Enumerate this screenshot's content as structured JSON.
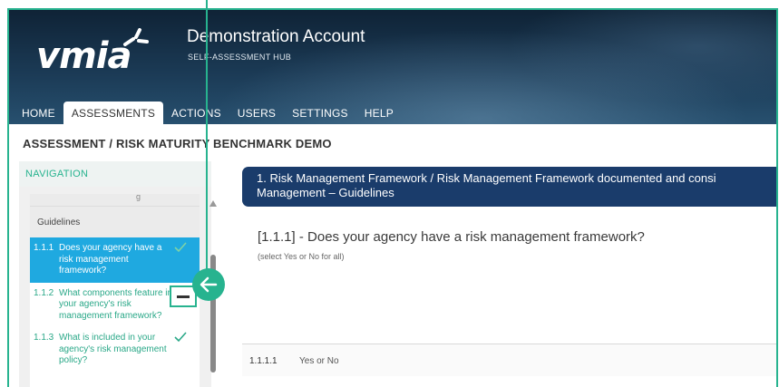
{
  "brand": {
    "logo_text": "vmia"
  },
  "account": {
    "title": "Demonstration Account",
    "subtitle": "SELF-ASSESSMENT HUB"
  },
  "nav": {
    "items": [
      {
        "label": "HOME"
      },
      {
        "label": "ASSESSMENTS",
        "active": true
      },
      {
        "label": "ACTIONS"
      },
      {
        "label": "USERS"
      },
      {
        "label": "SETTINGS"
      },
      {
        "label": "HELP"
      }
    ]
  },
  "breadcrumb": "ASSESSMENT / RISK MATURITY BENCHMARK DEMO",
  "sidebar": {
    "heading": "NAVIGATION",
    "group_label": "Guidelines",
    "items": [
      {
        "num": "1.1.1",
        "text": "Does your agency have a risk management framework?",
        "active": true,
        "completed": true
      },
      {
        "num": "1.1.2",
        "text": "What components feature in your agency's risk management framework?",
        "active": false,
        "completed": false
      },
      {
        "num": "1.1.3",
        "text": "What is included in your agency's risk management policy?",
        "active": false,
        "completed": true
      }
    ]
  },
  "question": {
    "header_line1": "1. Risk Management Framework / Risk Management Framework documented and consi",
    "header_line2": "Management – Guidelines",
    "title": "[1.1.1] - Does your agency have a risk management framework?",
    "hint": "(select Yes or No for all)",
    "row_number": "1.1.1.1",
    "row_label": "Yes or No"
  },
  "colors": {
    "accent": "#27b38f",
    "active_item": "#1fa9e0",
    "header_navy": "#1a3c6b"
  },
  "icons": {
    "check": "check-icon",
    "arrow": "arrow-left-icon",
    "collapse": "minus-icon"
  }
}
